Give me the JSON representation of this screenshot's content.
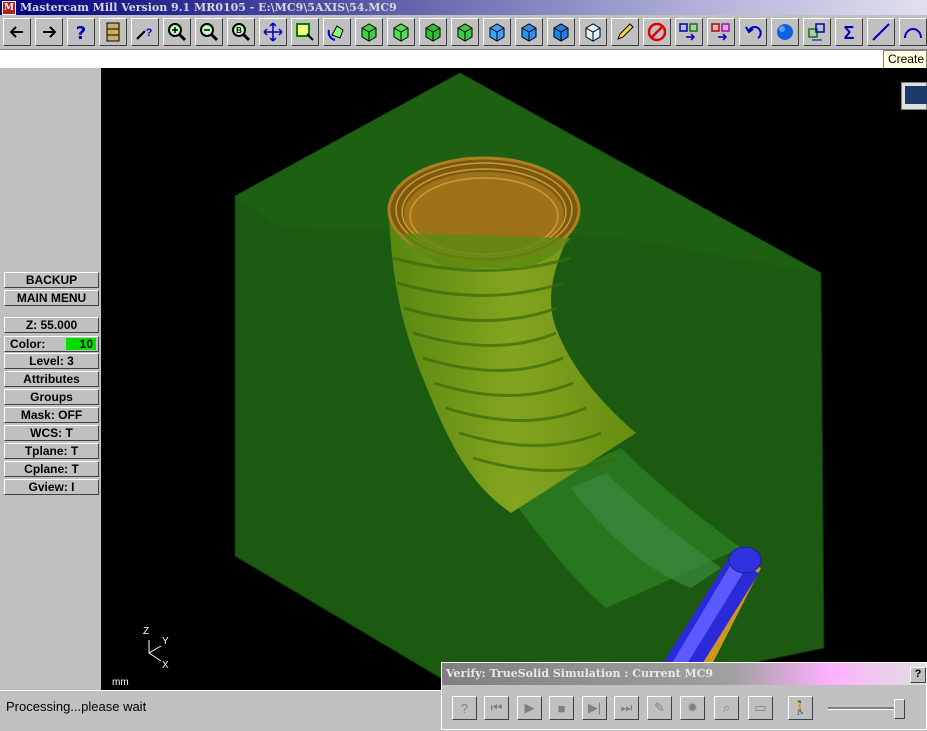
{
  "window": {
    "title": "Mastercam Mill Version 9.1 MR0105 - E:\\MC9\\5AXIS\\54.MC9"
  },
  "toolbar": {
    "buttons": [
      {
        "icon": "arrow-left-icon"
      },
      {
        "icon": "arrow-right-icon"
      },
      {
        "icon": "help-icon"
      },
      {
        "icon": "file-cabinet-icon"
      },
      {
        "icon": "analyze-icon"
      },
      {
        "icon": "zoom-in-icon"
      },
      {
        "icon": "zoom-out-icon"
      },
      {
        "icon": "zoom-previous-icon"
      },
      {
        "icon": "pan-icon"
      },
      {
        "icon": "zoom-window-icon"
      },
      {
        "icon": "rotate-view-icon"
      },
      {
        "icon": "view-top-icon"
      },
      {
        "icon": "view-front-icon"
      },
      {
        "icon": "view-side-icon"
      },
      {
        "icon": "view-iso-icon"
      },
      {
        "icon": "cube-blue-1-icon"
      },
      {
        "icon": "cube-blue-2-icon"
      },
      {
        "icon": "cube-blue-3-icon"
      },
      {
        "icon": "cube-blue-4-icon"
      },
      {
        "icon": "pencil-icon"
      },
      {
        "icon": "delete-icon"
      },
      {
        "icon": "transform-icon"
      },
      {
        "icon": "xform-color-icon"
      },
      {
        "icon": "undo-icon"
      },
      {
        "icon": "shade-sphere-icon"
      },
      {
        "icon": "copy-to-icon"
      },
      {
        "icon": "sum-icon"
      },
      {
        "icon": "line-icon"
      },
      {
        "icon": "arc-icon"
      }
    ],
    "create_label": "Create"
  },
  "menu": {
    "backup": "BACKUP",
    "main_menu": "MAIN MENU",
    "z": "Z:  55.000",
    "color_label": "Color:",
    "color_value": "10",
    "level": "Level:  3",
    "attributes": "Attributes",
    "groups": "Groups",
    "mask": "Mask:  OFF",
    "wcs": "WCS:   T",
    "tplane": "Tplane:  T",
    "cplane": "Cplane:  T",
    "gview": "Gview:   I"
  },
  "viewport": {
    "axis": {
      "z": "Z",
      "y": "Y",
      "x": "X"
    },
    "units": "mm"
  },
  "status": {
    "message": "Processing...please wait"
  },
  "verify": {
    "title": "Verify: TrueSolid Simulation : Current MC9",
    "help": "?",
    "buttons": [
      {
        "icon": "verify-options-icon"
      },
      {
        "icon": "rewind-icon"
      },
      {
        "icon": "play-icon"
      },
      {
        "icon": "stop-icon"
      },
      {
        "icon": "step-icon"
      },
      {
        "icon": "fast-forward-icon"
      },
      {
        "icon": "tool-icon"
      },
      {
        "icon": "light-icon"
      },
      {
        "icon": "zoom-verify-icon"
      },
      {
        "icon": "save-stl-icon"
      },
      {
        "icon": "walk-icon"
      }
    ],
    "speed": 0.9
  }
}
